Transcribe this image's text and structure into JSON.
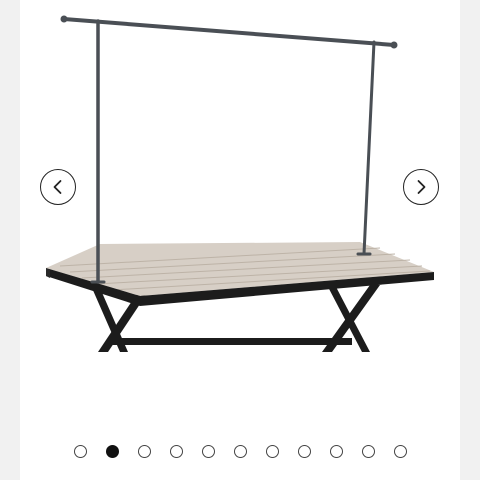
{
  "carousel": {
    "prev_icon": "chevron-left-icon",
    "next_icon": "chevron-right-icon",
    "slide_count": 11,
    "active_index": 1
  },
  "colors": {
    "page_bg": "#f1f1f1",
    "card_bg": "#ffffff",
    "tabletop": "#cfc6bb",
    "frame_metal": "#1c1c1c",
    "rail_metal": "#4a4f55"
  }
}
